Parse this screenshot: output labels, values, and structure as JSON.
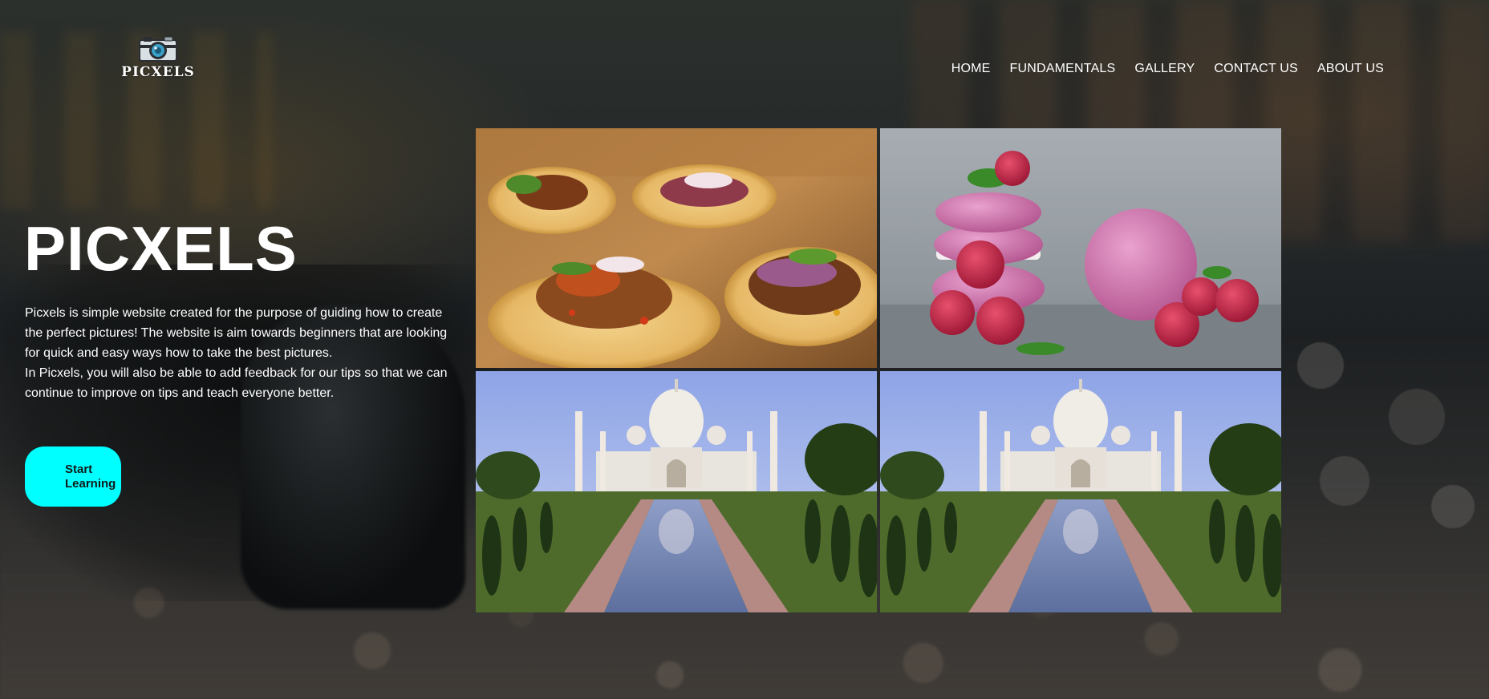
{
  "header": {
    "logo_text": "PICXELS",
    "nav": [
      "HOME",
      "FUNDAMENTALS",
      "GALLERY",
      "CONTACT US",
      "ABOUT US"
    ]
  },
  "hero": {
    "title": "PICXELS",
    "description_lines": [
      "Picxels is simple website created for the purpose of guiding how to create the perfect pictures! The website is aim towards beginners that are looking for quick and easy ways how to take the best pictures.",
      "In Picxels, you will also be able to add feedback for our tips so that we can continue to improve on tips and teach everyone better."
    ],
    "cta_label_line1": "Start",
    "cta_label_line2": "Learning"
  },
  "gallery": {
    "images": [
      "tacos-photo",
      "raspberry-macarons-photo",
      "taj-mahal-photo",
      "taj-mahal-photo"
    ]
  },
  "colors": {
    "accent": "#00ffff",
    "text": "#ffffff"
  }
}
